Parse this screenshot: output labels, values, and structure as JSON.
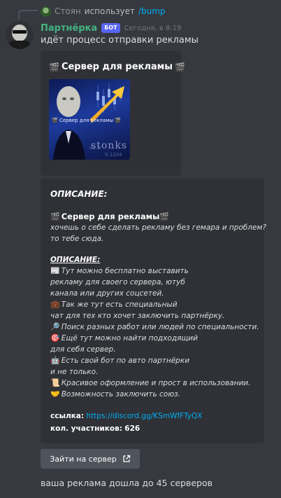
{
  "reply": {
    "username": "Стоян",
    "action": "использует",
    "command": "/bump"
  },
  "message": {
    "author": "Партнёрка",
    "bot_tag": "БОТ",
    "timestamp": "Сегодня, в 8:19",
    "text": "идёт процесс отправки рекламы"
  },
  "embed1": {
    "title": "Сервер для рекламы",
    "thumbnail_caption": "🎬 Сервер для рекламы 🎬",
    "thumbnail_brand": "stonks"
  },
  "embed2": {
    "heading": "ОПИСАНИЕ:",
    "server_title": "Сервер для рекламы",
    "intro_1": "хочешь о себе сделать рекламу без гемара и проблем?",
    "intro_2": "то тебе сюда.",
    "heading_2": "ОПИСАНИЕ:",
    "lines": [
      {
        "icon": "📰",
        "text": "Тут можно бесплатно выставить"
      },
      {
        "icon": "",
        "text": "рекламу для своего сервера, ютуб"
      },
      {
        "icon": "",
        "text": "канала или других соцсетей."
      },
      {
        "icon": "💼",
        "text": "Так же тут есть специальный"
      },
      {
        "icon": "",
        "text": "чат для тех кто хочет заключить партнёрку."
      },
      {
        "icon": "🔎",
        "text": "Поиск разных работ или людей по специальности."
      },
      {
        "icon": "🎯",
        "text": "Ещё тут можно найти подходящий"
      },
      {
        "icon": "",
        "text": "для себя сервер."
      },
      {
        "icon": "🤖",
        "text": "Есть свой бот по авто партнёрки"
      },
      {
        "icon": "",
        "text": "и не только."
      },
      {
        "icon": "📜",
        "text": "Красивое оформление и прост в использовании."
      },
      {
        "icon": "🤝",
        "text": "Возможность заключить союз."
      }
    ],
    "link_label": "ссылка:",
    "link_url": "https://discord.gg/KSmWfFTyQX",
    "members_label": "кол. участников:",
    "members_count": "626"
  },
  "button": {
    "label": "Зайти на сервер",
    "icon": "external-link-icon"
  },
  "footer": {
    "text": "ваша реклама дошла до 45 серверов"
  },
  "colors": {
    "background": "#36393f",
    "embed_bg": "#2f3136",
    "author": "#43b581",
    "bot_tag": "#5865f2",
    "link": "#00aff4",
    "button": "#4f545c"
  }
}
